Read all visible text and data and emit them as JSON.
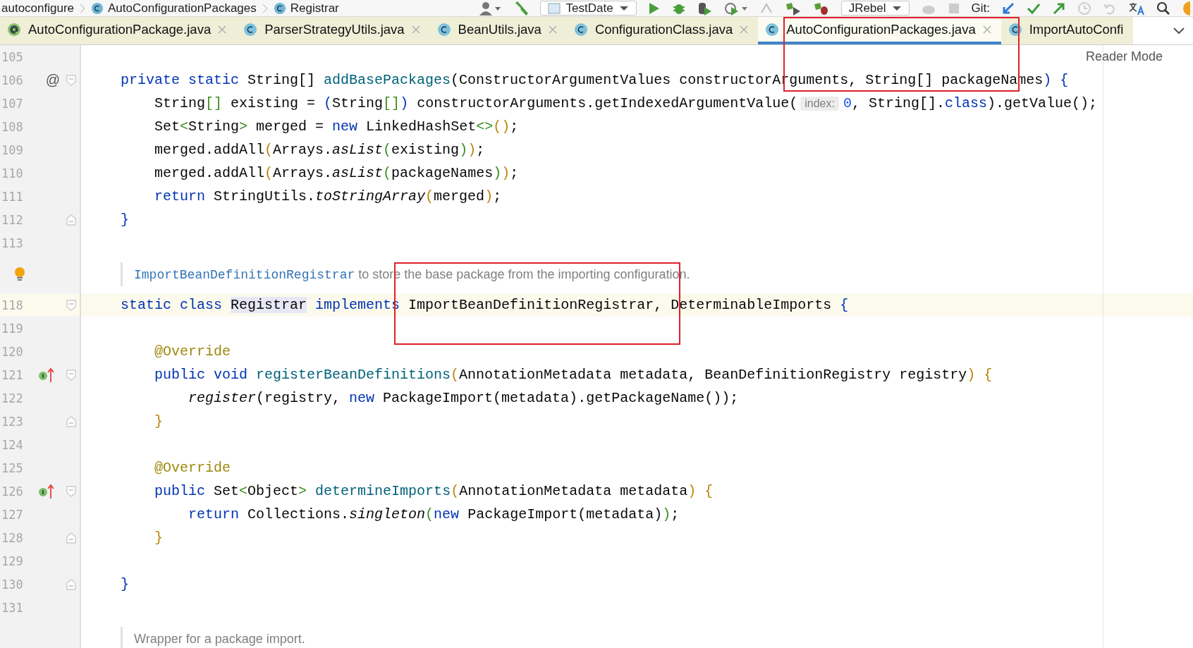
{
  "breadcrumb": [
    "autoconfigure",
    "AutoConfigurationPackages",
    "Registrar"
  ],
  "toolbar": {
    "run_config": "TestDate",
    "jrebel": "JRebel",
    "git_label": "Git:"
  },
  "tabs": [
    {
      "label": "AutoConfigurationPackage.java",
      "kind": "annotation",
      "selected": false,
      "closable": true
    },
    {
      "label": "ParserStrategyUtils.java",
      "kind": "class",
      "selected": false,
      "closable": true
    },
    {
      "label": "BeanUtils.java",
      "kind": "class",
      "selected": false,
      "closable": true
    },
    {
      "label": "ConfigurationClass.java",
      "kind": "class",
      "selected": false,
      "closable": true
    },
    {
      "label": "AutoConfigurationPackages.java",
      "kind": "class",
      "selected": true,
      "closable": true
    },
    {
      "label": "ImportAutoConfi",
      "kind": "class",
      "selected": false,
      "closable": false
    }
  ],
  "reader_mode": "Reader Mode",
  "lines": [
    {
      "kind": "code",
      "number": "105",
      "current": false
    },
    {
      "kind": "code",
      "number": "106",
      "current": false,
      "gutter_mark": "@",
      "fold": {
        "kind": "start"
      },
      "tokens": [
        {
          "t": "private static",
          "kind": "kw"
        },
        {
          "t": " String[] ",
          "kind": "plain"
        },
        {
          "t": "addBasePackages",
          "kind": "decl"
        },
        {
          "t": "(ConstructorArgumentValues constructorArguments, String[] packageNames",
          "kind": "plain"
        },
        {
          "t": ") {",
          "kind": "blue"
        }
      ]
    },
    {
      "kind": "code",
      "number": "107",
      "current": false,
      "tokens": [
        {
          "t": "    String",
          "kind": "plain"
        },
        {
          "t": "[]",
          "kind": "green"
        },
        {
          "t": " existing = ",
          "kind": "plain"
        },
        {
          "t": "(",
          "kind": "blue"
        },
        {
          "t": "String",
          "kind": "plain"
        },
        {
          "t": "[]",
          "kind": "green"
        },
        {
          "t": ")",
          "kind": "blue"
        },
        {
          "t": " constructorArguments.getIndexedArgumentValue(",
          "kind": "plain"
        },
        {
          "t": "index:",
          "kind": "hint"
        },
        {
          "t": "0",
          "kind": "num"
        },
        {
          "t": ", String[].",
          "kind": "plain"
        },
        {
          "t": "class",
          "kind": "kw"
        },
        {
          "t": ").getValue();",
          "kind": "plain"
        }
      ]
    },
    {
      "kind": "code",
      "number": "108",
      "current": false,
      "tokens": [
        {
          "t": "    Set",
          "kind": "plain"
        },
        {
          "t": "<",
          "kind": "green"
        },
        {
          "t": "String",
          "kind": "plain"
        },
        {
          "t": ">",
          "kind": "green"
        },
        {
          "t": " merged = ",
          "kind": "plain"
        },
        {
          "t": "new",
          "kind": "kw"
        },
        {
          "t": " LinkedHashSet",
          "kind": "plain"
        },
        {
          "t": "<>",
          "kind": "green"
        },
        {
          "t": "()",
          "kind": "gold"
        },
        {
          "t": ";",
          "kind": "plain"
        }
      ]
    },
    {
      "kind": "code",
      "number": "109",
      "current": false,
      "tokens": [
        {
          "t": "    merged.addAll",
          "kind": "plain"
        },
        {
          "t": "(",
          "kind": "gold"
        },
        {
          "t": "Arrays.",
          "kind": "plain"
        },
        {
          "t": "asList",
          "kind": "italic"
        },
        {
          "t": "(",
          "kind": "green"
        },
        {
          "t": "existing",
          "kind": "plain"
        },
        {
          "t": ")",
          "kind": "green"
        },
        {
          "t": ")",
          "kind": "gold"
        },
        {
          "t": ";",
          "kind": "plain"
        }
      ]
    },
    {
      "kind": "code",
      "number": "110",
      "current": false,
      "tokens": [
        {
          "t": "    merged.addAll",
          "kind": "plain"
        },
        {
          "t": "(",
          "kind": "gold"
        },
        {
          "t": "Arrays.",
          "kind": "plain"
        },
        {
          "t": "asList",
          "kind": "italic"
        },
        {
          "t": "(",
          "kind": "green"
        },
        {
          "t": "packageNames",
          "kind": "plain"
        },
        {
          "t": ")",
          "kind": "green"
        },
        {
          "t": ")",
          "kind": "gold"
        },
        {
          "t": ";",
          "kind": "plain"
        }
      ]
    },
    {
      "kind": "code",
      "number": "111",
      "current": false,
      "tokens": [
        {
          "t": "    return",
          "kind": "kw"
        },
        {
          "t": " StringUtils.",
          "kind": "plain"
        },
        {
          "t": "toStringArray",
          "kind": "italic"
        },
        {
          "t": "(",
          "kind": "gold"
        },
        {
          "t": "merged",
          "kind": "plain"
        },
        {
          "t": ")",
          "kind": "gold"
        },
        {
          "t": ";",
          "kind": "plain"
        }
      ]
    },
    {
      "kind": "code",
      "number": "112",
      "current": false,
      "fold": {
        "kind": "end"
      },
      "tokens": [
        {
          "t": "}",
          "kind": "blue"
        }
      ]
    },
    {
      "kind": "code",
      "number": "113",
      "current": false
    },
    {
      "kind": "doc",
      "bulb": true,
      "link": "ImportBeanDefinitionRegistrar",
      "text": " to store the base package from the importing configuration."
    },
    {
      "kind": "code",
      "number": "118",
      "current": true,
      "fold": {
        "kind": "start"
      },
      "tokens": [
        {
          "t": "static class ",
          "kind": "kw"
        },
        {
          "t": "Registrar",
          "kind": "hl"
        },
        {
          "t": " implements",
          "kind": "kw"
        },
        {
          "t": " ImportBeanDefinitionRegistrar, DeterminableImports ",
          "kind": "plain"
        },
        {
          "t": "{",
          "kind": "blue"
        }
      ]
    },
    {
      "kind": "code",
      "number": "119",
      "current": false
    },
    {
      "kind": "code",
      "number": "120",
      "current": false,
      "tokens": [
        {
          "t": "    @Override",
          "kind": "anno"
        }
      ]
    },
    {
      "kind": "code",
      "number": "121",
      "current": false,
      "gutter_icon": {
        "kind": "implements"
      },
      "fold": {
        "kind": "start"
      },
      "tokens": [
        {
          "t": "    public void ",
          "kind": "kw"
        },
        {
          "t": "registerBeanDefinitions",
          "kind": "decl"
        },
        {
          "t": "(",
          "kind": "gold"
        },
        {
          "t": "AnnotationMetadata metadata, BeanDefinitionRegistry registry",
          "kind": "plain"
        },
        {
          "t": ") {",
          "kind": "gold"
        }
      ]
    },
    {
      "kind": "code",
      "number": "122",
      "current": false,
      "tokens": [
        {
          "t": "        register",
          "kind": "italic"
        },
        {
          "t": "(registry, ",
          "kind": "plain"
        },
        {
          "t": "new",
          "kind": "kw"
        },
        {
          "t": " PackageImport(metadata).getPackageName());",
          "kind": "plain"
        }
      ]
    },
    {
      "kind": "code",
      "number": "123",
      "current": false,
      "fold": {
        "kind": "end"
      },
      "tokens": [
        {
          "t": "    }",
          "kind": "gold"
        }
      ]
    },
    {
      "kind": "code",
      "number": "124",
      "current": false
    },
    {
      "kind": "code",
      "number": "125",
      "current": false,
      "tokens": [
        {
          "t": "    @Override",
          "kind": "anno"
        }
      ]
    },
    {
      "kind": "code",
      "number": "126",
      "current": false,
      "gutter_icon": {
        "kind": "implements"
      },
      "fold": {
        "kind": "start"
      },
      "tokens": [
        {
          "t": "    public",
          "kind": "kw"
        },
        {
          "t": " Set",
          "kind": "plain"
        },
        {
          "t": "<",
          "kind": "green"
        },
        {
          "t": "Object",
          "kind": "plain"
        },
        {
          "t": ">",
          "kind": "green"
        },
        {
          "t": " determineImports",
          "kind": "decl"
        },
        {
          "t": "(",
          "kind": "gold"
        },
        {
          "t": "AnnotationMetadata metadata",
          "kind": "plain"
        },
        {
          "t": ") {",
          "kind": "gold"
        }
      ]
    },
    {
      "kind": "code",
      "number": "127",
      "current": false,
      "tokens": [
        {
          "t": "        return",
          "kind": "kw"
        },
        {
          "t": " Collections.",
          "kind": "plain"
        },
        {
          "t": "singleton",
          "kind": "italic"
        },
        {
          "t": "(",
          "kind": "green"
        },
        {
          "t": "new",
          "kind": "kw"
        },
        {
          "t": " PackageImport(metadata)",
          "kind": "plain"
        },
        {
          "t": ")",
          "kind": "green"
        },
        {
          "t": ";",
          "kind": "plain"
        }
      ]
    },
    {
      "kind": "code",
      "number": "128",
      "current": false,
      "fold": {
        "kind": "end"
      },
      "tokens": [
        {
          "t": "    }",
          "kind": "gold"
        }
      ]
    },
    {
      "kind": "code",
      "number": "129",
      "current": false
    },
    {
      "kind": "code",
      "number": "130",
      "current": false,
      "fold": {
        "kind": "end"
      },
      "tokens": [
        {
          "t": "}",
          "kind": "blue"
        }
      ]
    },
    {
      "kind": "code",
      "number": "131",
      "current": false
    },
    {
      "kind": "doc",
      "bulb": false,
      "text": "Wrapper for a package import."
    }
  ],
  "annotations": [
    {
      "kind": "box"
    },
    {
      "kind": "box"
    }
  ]
}
